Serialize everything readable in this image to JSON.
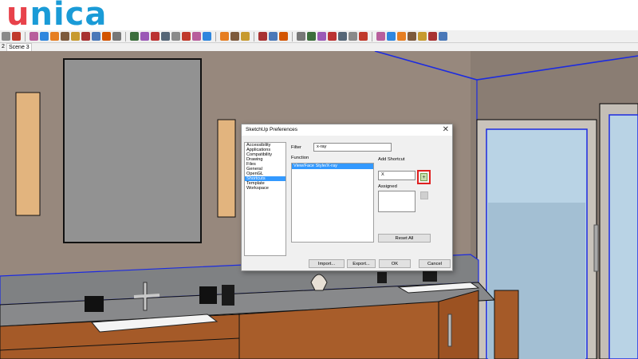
{
  "brand": {
    "logo_u": "u",
    "logo_rest": "nica",
    "colors": {
      "u": "#e8424b",
      "rest": "#1a9bd7"
    }
  },
  "tabs": {
    "first": "2",
    "scene": "Scene 3"
  },
  "dialog": {
    "title": "SketchUp Preferences",
    "close": "✕",
    "categories": [
      "Accessibility",
      "Applications",
      "Compatibility",
      "Drawing",
      "Files",
      "General",
      "OpenGL",
      "Shortcuts",
      "Template",
      "Workspace"
    ],
    "selected_category": "Shortcuts",
    "filter_label": "Filter",
    "filter_value": "x-ray",
    "function_label": "Function",
    "function_items": [
      "View/Face Style/X-ray"
    ],
    "add_shortcut_label": "Add Shortcut",
    "shortcut_value": "X",
    "plus": "+",
    "assigned_label": "Assigned",
    "reset_all": "Reset All",
    "import": "Import...",
    "export": "Export...",
    "ok": "OK",
    "cancel": "Cancel"
  }
}
